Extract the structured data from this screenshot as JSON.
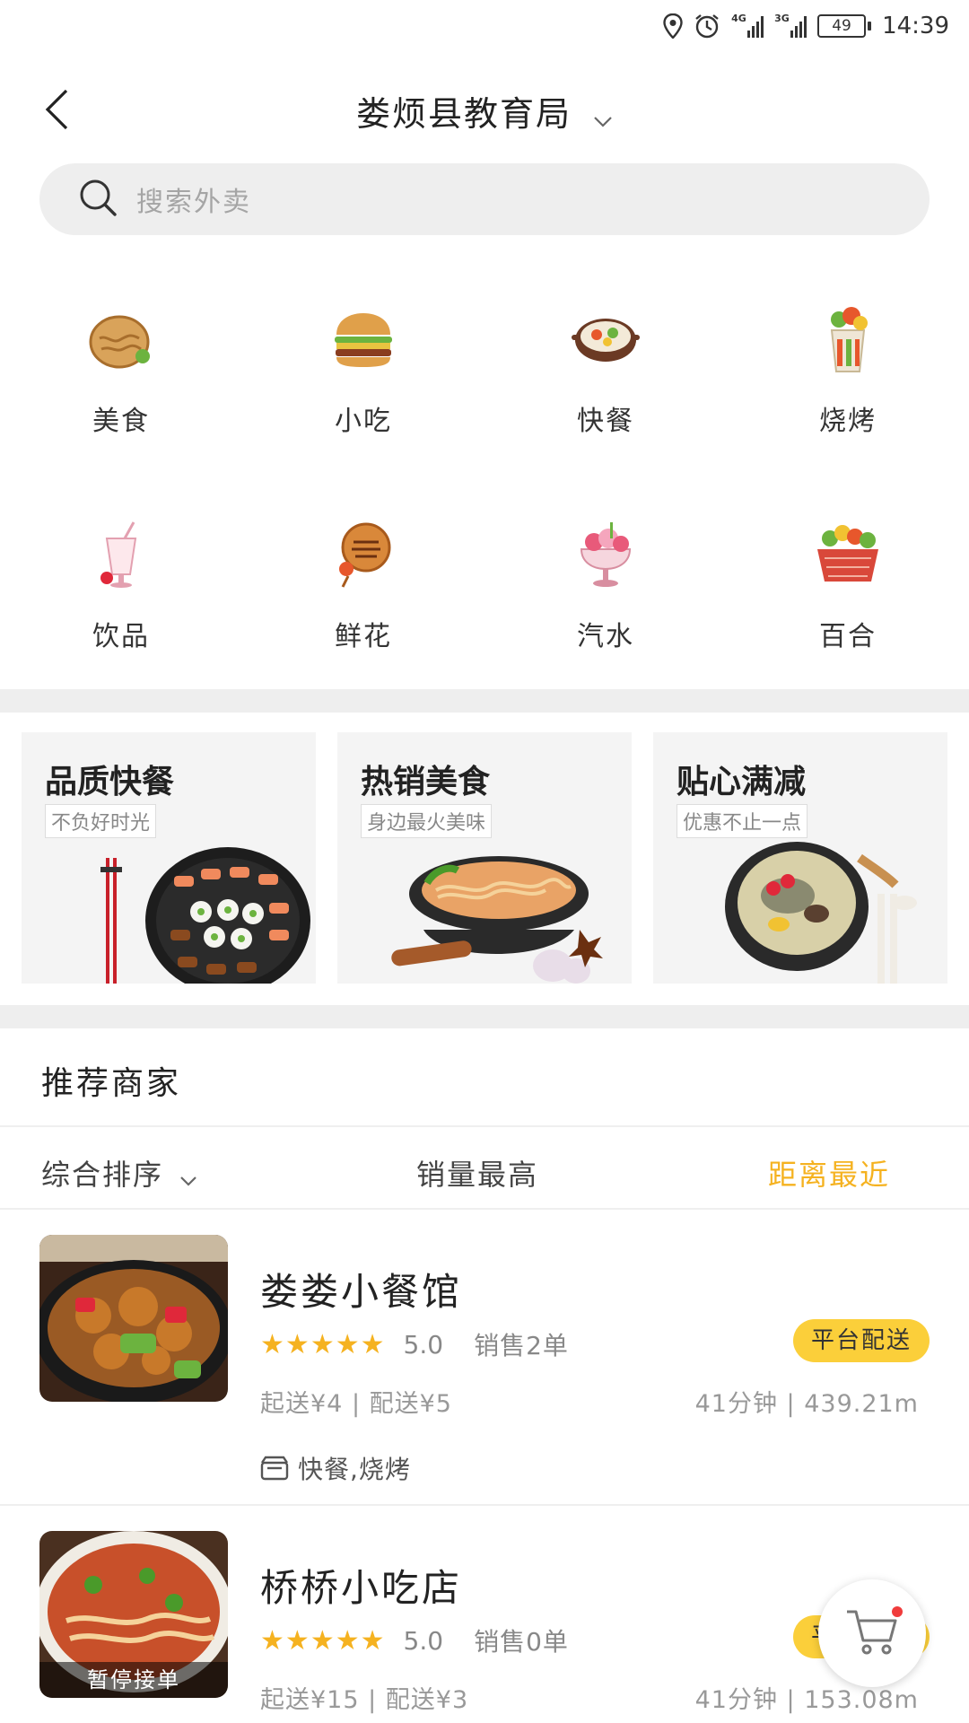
{
  "status_bar": {
    "network_1": "4G",
    "network_2": "3G",
    "battery": "49",
    "time": "14:39"
  },
  "header": {
    "title": "娄烦县教育局"
  },
  "search": {
    "placeholder": "搜索外卖"
  },
  "categories": [
    {
      "label": "美食",
      "icon": "pancake-icon"
    },
    {
      "label": "小吃",
      "icon": "burger-icon"
    },
    {
      "label": "快餐",
      "icon": "hotpot-icon"
    },
    {
      "label": "烧烤",
      "icon": "skewer-cup-icon"
    },
    {
      "label": "饮品",
      "icon": "drink-icon"
    },
    {
      "label": "鲜花",
      "icon": "cookie-icon"
    },
    {
      "label": "汽水",
      "icon": "icecream-icon"
    },
    {
      "label": "百合",
      "icon": "basket-icon"
    }
  ],
  "promos": [
    {
      "title": "品质快餐",
      "tag": "不负好时光"
    },
    {
      "title": "热销美食",
      "tag": "身边最火美味"
    },
    {
      "title": "贴心满减",
      "tag": "优惠不止一点"
    }
  ],
  "recommend": {
    "title": "推荐商家",
    "sort": {
      "default": "综合排序",
      "sales": "销量最高",
      "distance": "距离最近"
    }
  },
  "shops": [
    {
      "name": "娄娄小餐馆",
      "rating": "5.0",
      "sales": "销售2单",
      "fee": "起送¥4 | 配送¥5",
      "distance": "41分钟 | 439.21m",
      "badge": "平台配送",
      "tags": "快餐,烧烤"
    },
    {
      "name": "桥桥小吃店",
      "rating": "5.0",
      "sales": "销售0单",
      "fee": "起送¥15 | 配送¥3",
      "distance": "41分钟 | 153.08m",
      "badge": "平台配送",
      "status": "暂停接单"
    }
  ],
  "colors": {
    "accent": "#f5b220",
    "badge": "#fbcf3a",
    "divider": "#eeeeee"
  }
}
